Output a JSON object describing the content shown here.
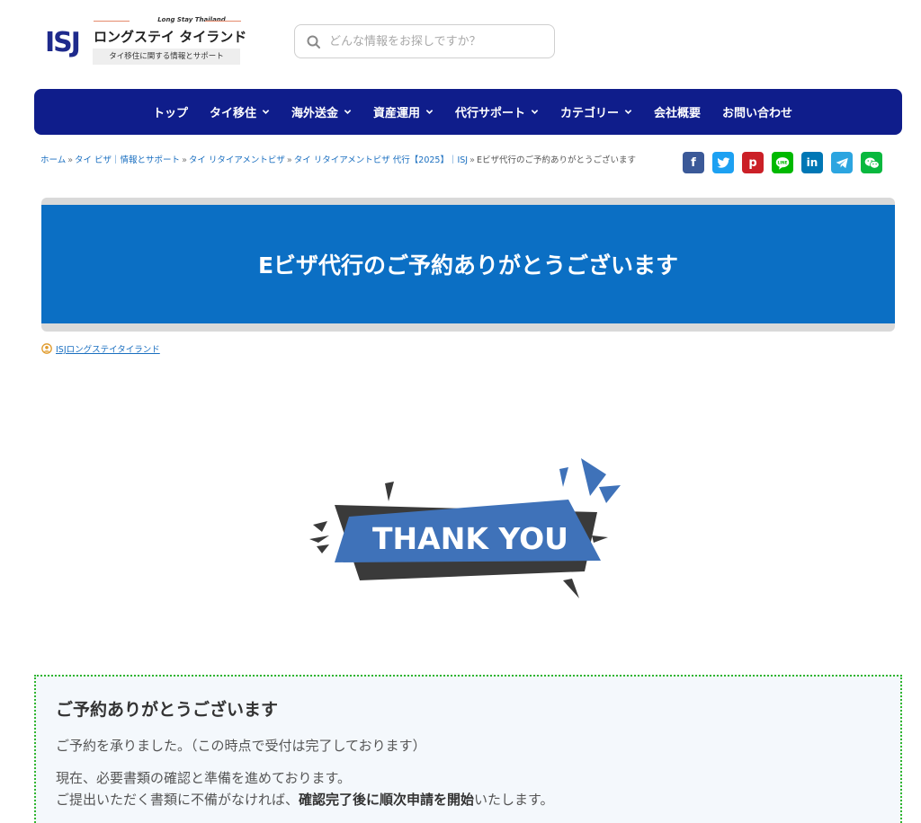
{
  "logo": {
    "mark": "ISJ",
    "tagline_en": "Long Stay Thailand",
    "title": "ロングステイ タイランド",
    "tag": "タイ移住に関する情報とサポート"
  },
  "search": {
    "placeholder": "どんな情報をお探しですか？"
  },
  "nav": {
    "items": [
      {
        "label": "トップ",
        "dropdown": false
      },
      {
        "label": "タイ移住",
        "dropdown": true
      },
      {
        "label": "海外送金",
        "dropdown": true
      },
      {
        "label": "資産運用",
        "dropdown": true
      },
      {
        "label": "代行サポート",
        "dropdown": true
      },
      {
        "label": "カテゴリー",
        "dropdown": true
      },
      {
        "label": "会社概要",
        "dropdown": false
      },
      {
        "label": "お問い合わせ",
        "dropdown": false
      }
    ],
    "bg_color": "#0f1d8b"
  },
  "breadcrumb": {
    "items": [
      "ホーム",
      "タイ ビザ｜情報とサポート",
      "タイ リタイアメントビザ",
      "タイ リタイアメントビザ 代行【2025】｜ISJ"
    ],
    "current": "Eビザ代行のご予約ありがとうございます"
  },
  "share": [
    {
      "name": "facebook",
      "glyph": "f",
      "color": "#3b5998"
    },
    {
      "name": "twitter",
      "glyph": "t",
      "color": "#1da1f2"
    },
    {
      "name": "pinterest",
      "glyph": "p",
      "color": "#cb2027"
    },
    {
      "name": "line",
      "glyph": "L",
      "color": "#00b900"
    },
    {
      "name": "linkedin",
      "glyph": "in",
      "color": "#0077b5"
    },
    {
      "name": "telegram",
      "glyph": "➤",
      "color": "#2ca5e0"
    },
    {
      "name": "wechat",
      "glyph": "w",
      "color": "#09b83e"
    }
  ],
  "page": {
    "title": "Eビザ代行のご予約ありがとうございます",
    "author": "ISJロングステイタイランド",
    "banner_color": "#0b6fc4"
  },
  "thanks": {
    "text": "THANK YOU",
    "accent": "#3f72b9",
    "dark": "#3a3a3a"
  },
  "message": {
    "heading": "ご予約ありがとうございます",
    "line1": "ご予約を承りました。（この時点で受付は完了しております）",
    "line2": "現在、必要書類の確認と準備を進めております。",
    "line3_pre": "ご提出いただく書類に不備がなければ、",
    "line3_bold": "確認完了後に順次申請を開始",
    "line3_post": "いたします。"
  }
}
